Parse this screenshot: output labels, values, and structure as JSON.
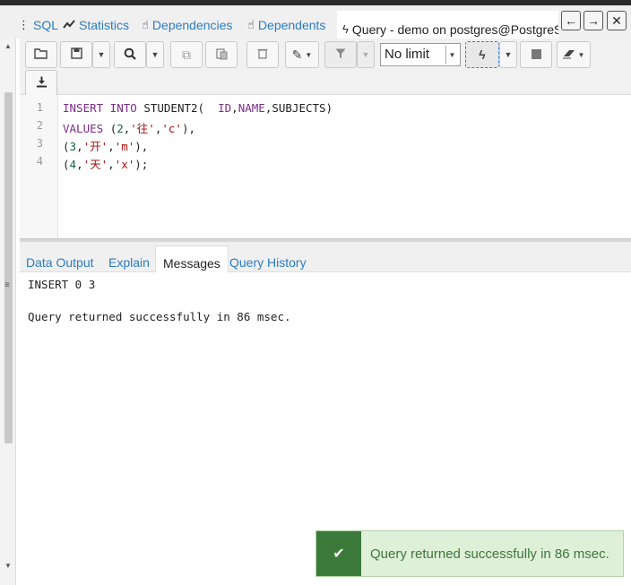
{
  "tabs": [
    {
      "label": "SQL",
      "icon": "sql-icon"
    },
    {
      "label": "Statistics",
      "icon": "chart-line-icon"
    },
    {
      "label": "Dependencies",
      "icon": "hand-pointer-icon"
    },
    {
      "label": "Dependents",
      "icon": "hand-pointer-icon"
    },
    {
      "label": "Query - demo on postgres@PostgreSQL",
      "icon": "bolt-icon",
      "active": true
    }
  ],
  "nav": {
    "back": "←",
    "forward": "→",
    "close": "✕"
  },
  "toolbar": {
    "limit_value": "No limit"
  },
  "editor": {
    "lines": [
      {
        "num": "1",
        "parts": [
          {
            "t": "INSERT INTO ",
            "c": "kw"
          },
          {
            "t": "STUDENT2(  ",
            "c": ""
          },
          {
            "t": "ID",
            "c": "kw"
          },
          {
            "t": ",",
            "c": ""
          },
          {
            "t": "NAME",
            "c": "kw"
          },
          {
            "t": ",SUBJECTS)",
            "c": ""
          }
        ]
      },
      {
        "num": "2",
        "parts": [
          {
            "t": "VALUES ",
            "c": "kw"
          },
          {
            "t": "(",
            "c": ""
          },
          {
            "t": "2",
            "c": "num"
          },
          {
            "t": ",",
            "c": ""
          },
          {
            "t": "'往'",
            "c": "str"
          },
          {
            "t": ",",
            "c": ""
          },
          {
            "t": "'c'",
            "c": "str"
          },
          {
            "t": "),",
            "c": ""
          }
        ]
      },
      {
        "num": "3",
        "parts": [
          {
            "t": "(",
            "c": ""
          },
          {
            "t": "3",
            "c": "num"
          },
          {
            "t": ",",
            "c": ""
          },
          {
            "t": "'开'",
            "c": "str"
          },
          {
            "t": ",",
            "c": ""
          },
          {
            "t": "'m'",
            "c": "str"
          },
          {
            "t": "),",
            "c": ""
          }
        ]
      },
      {
        "num": "4",
        "parts": [
          {
            "t": "(",
            "c": ""
          },
          {
            "t": "4",
            "c": "num"
          },
          {
            "t": ",",
            "c": ""
          },
          {
            "t": "'天'",
            "c": "str"
          },
          {
            "t": ",",
            "c": ""
          },
          {
            "t": "'x'",
            "c": "str"
          },
          {
            "t": ");",
            "c": ""
          }
        ]
      }
    ]
  },
  "results_tabs": [
    {
      "label": "Data Output"
    },
    {
      "label": "Explain"
    },
    {
      "label": "Messages",
      "active": true
    },
    {
      "label": "Query History"
    }
  ],
  "messages": {
    "line1": "INSERT 0 3",
    "line2": "Query returned successfully in 86 msec."
  },
  "toast": {
    "text": "Query returned successfully in 86 msec.",
    "icon": "check-icon"
  },
  "colors": {
    "link": "#2c7cc1",
    "keyword": "#7b2a8a",
    "string": "#aa1111",
    "number": "#116644",
    "toast_bg": "#dff0d8",
    "toast_icon_bg": "#3c7a3c"
  }
}
